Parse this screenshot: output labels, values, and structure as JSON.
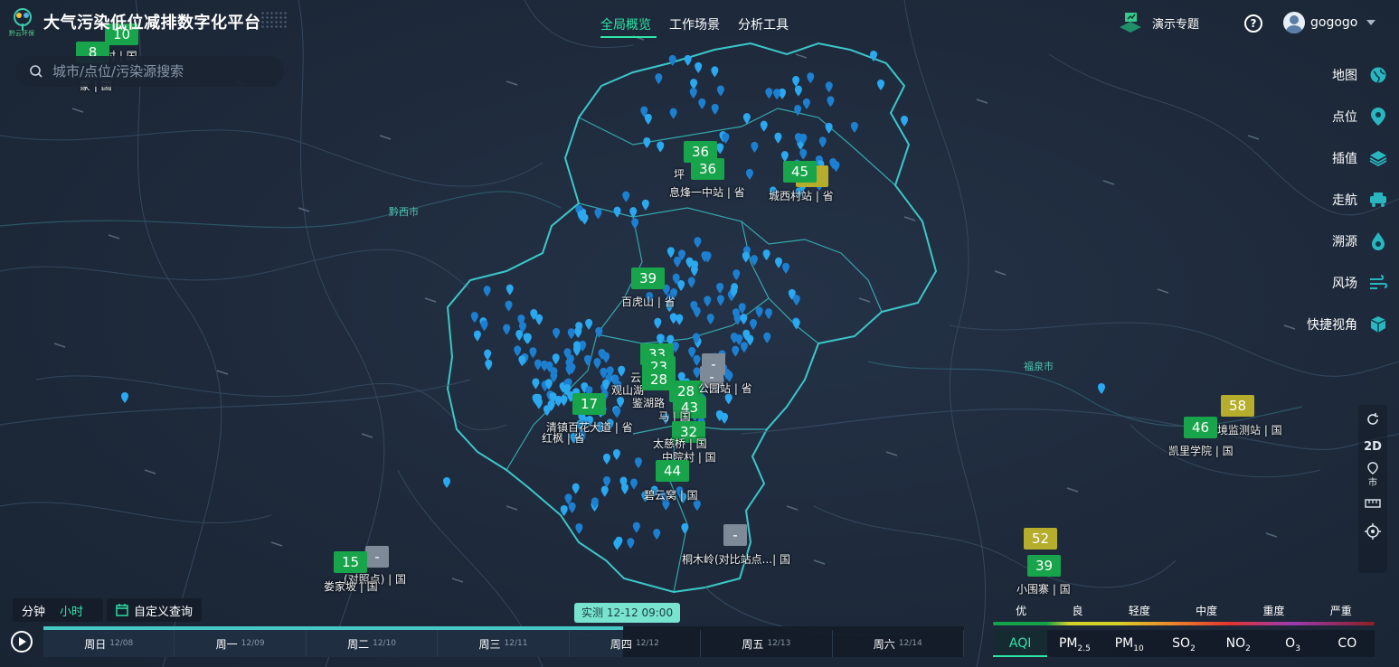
{
  "header": {
    "title": "大气污染低位减排数字化平台",
    "logo_text": "黔云环保",
    "nav": [
      {
        "label": "全局概览",
        "active": true
      },
      {
        "label": "工作场景",
        "active": false
      },
      {
        "label": "分析工具",
        "active": false
      }
    ],
    "demo_label": "演示专题",
    "help_symbol": "?",
    "username": "gogogo"
  },
  "search": {
    "placeholder": "城市/点位/污染源搜索"
  },
  "toolbar": [
    {
      "label": "地图",
      "icon": "globe-icon"
    },
    {
      "label": "点位",
      "icon": "pin-icon"
    },
    {
      "label": "插值",
      "icon": "layers-icon"
    },
    {
      "label": "走航",
      "icon": "vehicle-icon"
    },
    {
      "label": "溯源",
      "icon": "source-icon"
    },
    {
      "label": "风场",
      "icon": "wind-icon"
    },
    {
      "label": "快捷视角",
      "icon": "cube-icon"
    }
  ],
  "map_controls": [
    "refresh-icon",
    "2D",
    "市",
    "ruler-icon",
    "locate-icon"
  ],
  "map_controls_text": {
    "mode": "2D",
    "level": "市"
  },
  "cities": [
    "黔西市",
    "福泉市"
  ],
  "stations": {
    "s_top1": {
      "value": "10",
      "name": "村 | 国"
    },
    "s_top2": {
      "value": "8",
      "name": "蒙 | 国"
    },
    "s_pingba": {
      "value": "36",
      "name": "坪"
    },
    "s_xifeng": {
      "value": "36",
      "name": "息烽一中站 | 省"
    },
    "s_chengxi": {
      "value": "45",
      "name": "城西村站 | 省"
    },
    "s_baihu": {
      "value": "39",
      "name": "百虎山 | 省"
    },
    "s_c1": {
      "value": "33",
      "name": "云"
    },
    "s_c2": {
      "value": "23",
      "name": "观山湖"
    },
    "s_c3": {
      "value": "28",
      "name": "鉴湖路"
    },
    "s_c4": {
      "value": "28",
      "name": "公园站 | 省"
    },
    "s_c5": {
      "value": "43",
      "name": "马 | 国"
    },
    "s_c6": {
      "value": "32",
      "name": "太慈桥 | 国"
    },
    "s_c7": {
      "value": "-",
      "name": ""
    },
    "s_c8": {
      "value": "-",
      "name": ""
    },
    "s_qingzhen": {
      "value": "17",
      "name": "清镇百花大道 | 省"
    },
    "s_hongfeng": {
      "value": "",
      "name": "红枫 | 省"
    },
    "s_zhongyuan": {
      "value": "",
      "name": "中院村 | 国"
    },
    "s_biyun": {
      "value": "44",
      "name": "碧云窝 | 国"
    },
    "s_tongmu": {
      "value": "-",
      "name": "桐木岭(对比站点...| 国"
    },
    "s_louba": {
      "value": "15",
      "name": "娄家坡 | 国"
    },
    "s_loub2": {
      "value": "-",
      "name": "(对照点) | 国"
    },
    "s_kaili1": {
      "value": "58",
      "name": "境监测站 | 国"
    },
    "s_kaili2": {
      "value": "46",
      "name": "凯里学院 | 国"
    },
    "s_duyun1": {
      "value": "52",
      "name": ""
    },
    "s_duyun2": {
      "value": "39",
      "name": "小围寨 | 国"
    }
  },
  "bottom": {
    "granularity": {
      "minute": "分钟",
      "hour": "小时"
    },
    "custom_query": "自定义查询",
    "current_time": "实测 12-12 09:00",
    "progress_fraction": 0.63,
    "days": [
      {
        "label": "周日",
        "date": "12/08"
      },
      {
        "label": "周一",
        "date": "12/09"
      },
      {
        "label": "周二",
        "date": "12/10"
      },
      {
        "label": "周三",
        "date": "12/11"
      },
      {
        "label": "周四",
        "date": "12/12"
      },
      {
        "label": "周五",
        "date": "12/13"
      },
      {
        "label": "周六",
        "date": "12/14"
      }
    ]
  },
  "legend": {
    "levels": [
      "优",
      "良",
      "轻度",
      "中度",
      "重度",
      "严重"
    ],
    "colors": [
      "#15a04a",
      "#d6d12a",
      "#ee8a2a",
      "#e2352f",
      "#9a3bb0",
      "#8e1f24"
    ]
  },
  "pollutants": {
    "active": "AQI",
    "aqi": "AQI",
    "pm25_base": "PM",
    "pm25_sub": "2.5",
    "pm10_base": "PM",
    "pm10_sub": "10",
    "so2_base": "SO",
    "so2_sub": "2",
    "no2_base": "NO",
    "no2_sub": "2",
    "o3_base": "O",
    "o3_sub": "3",
    "co": "CO"
  }
}
